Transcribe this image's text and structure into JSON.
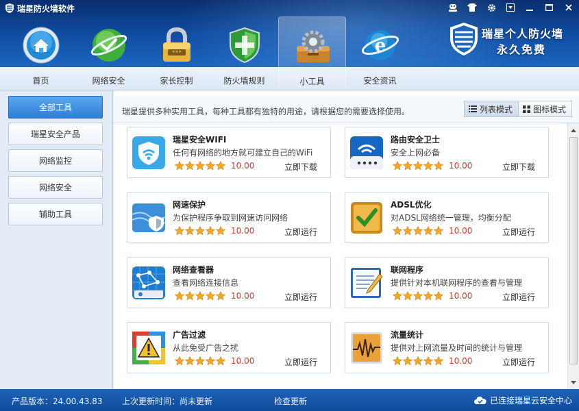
{
  "window": {
    "title": "瑞星防火墙软件"
  },
  "nav": [
    {
      "label": "首页",
      "icon": "home-icon"
    },
    {
      "label": "网络安全",
      "icon": "globe-check-icon"
    },
    {
      "label": "家长控制",
      "icon": "padlock-icon"
    },
    {
      "label": "防火墙规则",
      "icon": "shield-icon"
    },
    {
      "label": "小工具",
      "icon": "toolbox-gear-icon",
      "active": true
    },
    {
      "label": "安全资讯",
      "icon": "internet-explorer-icon"
    }
  ],
  "brand": {
    "line1": "瑞星个人防火墙",
    "line2": "永久免费"
  },
  "sidebar": [
    {
      "label": "全部工具",
      "active": true
    },
    {
      "label": "瑞星安全产品"
    },
    {
      "label": "网络监控"
    },
    {
      "label": "网络安全"
    },
    {
      "label": "辅助工具"
    }
  ],
  "intro": "瑞星提供多种实用工具，每种工具都有独特的用途，请根据您的需要选择使用。",
  "view": {
    "list": "列表模式",
    "grid": "图标模式"
  },
  "tools": [
    {
      "name": "瑞星安全WIFI",
      "desc": "任何有网络的地方就可建立自己的WiFi",
      "rating": 5,
      "score": "10.00",
      "action": "立即下载",
      "icon": "wifi-icon"
    },
    {
      "name": "路由安全卫士",
      "desc": "安全上网必备",
      "rating": 5,
      "score": "10.00",
      "action": "立即下载",
      "icon": "router-icon"
    },
    {
      "name": "网速保护",
      "desc": "为保护程序争取到网速访问网络",
      "rating": 5,
      "score": "10.00",
      "action": "立即运行",
      "icon": "speed-shield-icon"
    },
    {
      "name": "ADSL优化",
      "desc": "对ADSL网络统一管理，均衡分配",
      "rating": 5,
      "score": "10.00",
      "action": "立即运行",
      "icon": "check-box-icon"
    },
    {
      "name": "网络查看器",
      "desc": "查看网络连接信息",
      "rating": 5,
      "score": "10.00",
      "action": "立即运行",
      "icon": "network-map-icon"
    },
    {
      "name": "联网程序",
      "desc": "提供针对本机联网程序的查看与管理",
      "rating": 5,
      "score": "10.00",
      "action": "立即运行",
      "icon": "notepad-icon"
    },
    {
      "name": "广告过滤",
      "desc": "从此免受广告之扰",
      "rating": 5,
      "score": "10.00",
      "action": "立即运行",
      "icon": "warning-icon"
    },
    {
      "name": "流量统计",
      "desc": "提供对上网流量及时间的统计与管理",
      "rating": 5,
      "score": "10.00",
      "action": "立即运行",
      "icon": "traffic-chart-icon"
    }
  ],
  "status": {
    "version": "产品版本：24.00.43.83",
    "last_update": "上次更新时间：尚未更新",
    "check_update": "检查更新",
    "cloud": "已连接瑞星云安全中心"
  },
  "colors": {
    "accent": "#2d7fd5",
    "score": "#d23a2a",
    "star": "#f5a623"
  }
}
